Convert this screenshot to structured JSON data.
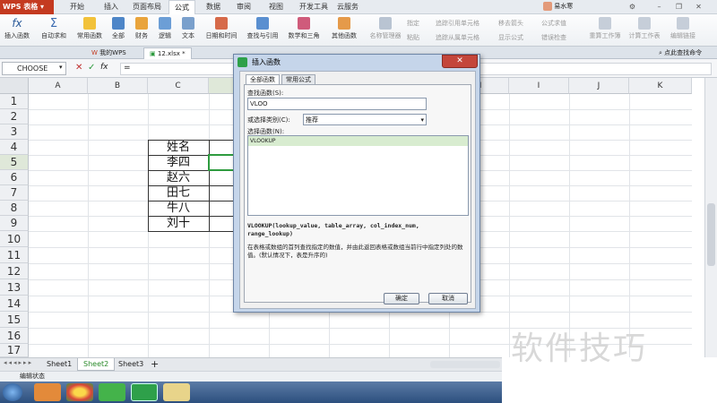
{
  "app": {
    "name": "WPS 表格"
  },
  "menu": {
    "tabs": [
      "开始",
      "插入",
      "页面布局",
      "公式",
      "数据",
      "审阅",
      "视图",
      "开发工具",
      "云服务"
    ],
    "active": "公式"
  },
  "user": {
    "name": "易水寒"
  },
  "ribbon": {
    "buttons": [
      "插入函数",
      "自动求和",
      "常用函数",
      "全部",
      "财务",
      "逻辑",
      "文本",
      "日期和时间",
      "查找与引用",
      "数学和三角",
      "其他函数",
      "名称管理器"
    ],
    "small": [
      "指定",
      "粘贴",
      "追踪引用单元格",
      "追踪从属单元格",
      "移去箭头",
      "显示公式",
      "公式求值",
      "错误检查",
      "重算工作簿",
      "计算工作表",
      "编辑链接"
    ]
  },
  "doctabs": {
    "wps": "我的WPS",
    "file": "12.xlsx *",
    "search": "点此查找命令"
  },
  "formula": {
    "namebox": "CHOOSE",
    "fx": "fx",
    "content": "="
  },
  "grid": {
    "columns": [
      "A",
      "B",
      "C",
      "D",
      "E",
      "F",
      "G",
      "H",
      "I",
      "J",
      "K"
    ],
    "rows": [
      "1",
      "2",
      "3",
      "4",
      "5",
      "6",
      "7",
      "8",
      "9",
      "10",
      "11",
      "12",
      "13",
      "14",
      "15",
      "16",
      "17"
    ],
    "cells": {
      "c4": "姓名",
      "d4": "语",
      "c5": "李四",
      "c6": "赵六",
      "c7": "田七",
      "c8": "牛八",
      "c9": "刘十"
    }
  },
  "sheets": {
    "tabs": [
      "Sheet1",
      "Sheet2",
      "Sheet3"
    ],
    "active": "Sheet2",
    "add": "+"
  },
  "status": {
    "text": "编辑状态"
  },
  "dialog": {
    "title": "插入函数",
    "tabs": [
      "全部函数",
      "常用公式"
    ],
    "search_label": "查找函数(S):",
    "search_value": "VLOO",
    "category_label": "或选择类别(C):",
    "category_value": "推荐",
    "select_label": "选择函数(N):",
    "result": "VLOOKUP",
    "signature": "VLOOKUP(lookup_value, table_array, col_index_num, range_lookup)",
    "description": "在表格或数组的首列查找指定的数值，并由此返回表格或数组当前行中指定列处的数值。(默认情况下，表是升序的)",
    "ok": "确定",
    "cancel": "取消"
  },
  "watermark": "软件技巧",
  "colors": {
    "accent": "#c43a20",
    "active_cell": "#2e9b3f",
    "dialog_frame": "#c5d5ea"
  }
}
